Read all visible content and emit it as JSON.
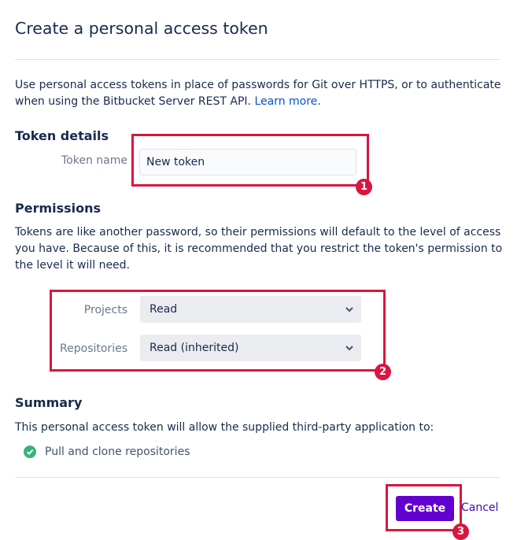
{
  "page": {
    "title": "Create a personal access token"
  },
  "intro": {
    "text": "Use personal access tokens in place of passwords for Git over HTTPS, or to authenticate when using the Bitbucket Server REST API. ",
    "link": "Learn more",
    "suffix": "."
  },
  "token_details": {
    "title": "Token details",
    "name_label": "Token name",
    "name_value": "New token"
  },
  "permissions": {
    "title": "Permissions",
    "description": "Tokens are like another password, so their permissions will default to the level of access you have. Because of this, it is recommended that you restrict the token's permission to the level it will need.",
    "projects_label": "Projects",
    "projects_value": "Read",
    "repositories_label": "Repositories",
    "repositories_value": "Read (inherited)"
  },
  "summary": {
    "title": "Summary",
    "description": "This personal access token will allow the supplied third-party application to:",
    "items": [
      "Pull and clone repositories"
    ]
  },
  "actions": {
    "create_label": "Create",
    "cancel_label": "Cancel"
  },
  "annotations": [
    "1",
    "2",
    "3"
  ],
  "colors": {
    "accent": "#6200d1",
    "annotation": "#d9163f",
    "success": "#36b37e",
    "link": "#0052cc"
  }
}
